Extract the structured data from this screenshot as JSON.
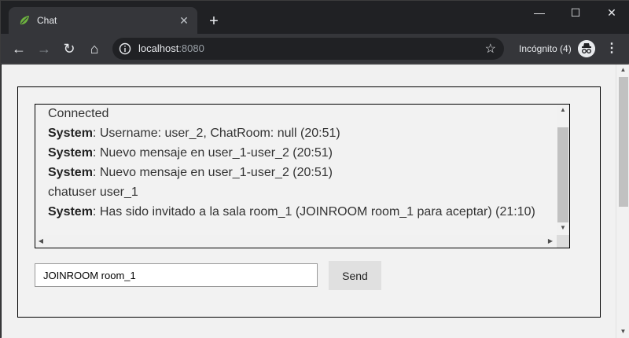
{
  "browser": {
    "tab_title": "Chat",
    "url_host": "localhost",
    "url_port": ":8080",
    "incognito_label": "Incógnito (4)",
    "icons": {
      "favicon": "spring-leaf-icon",
      "close": "close-icon",
      "new_tab": "plus-icon",
      "back": "back-arrow-icon",
      "forward": "forward-arrow-icon",
      "reload": "reload-icon",
      "home": "home-icon",
      "info": "info-icon",
      "star": "star-icon",
      "incognito": "incognito-icon",
      "menu": "kebab-menu-icon"
    },
    "colors": {
      "frame": "#202124",
      "toolbar": "#35363a",
      "favicon_green": "#6db33f"
    }
  },
  "chat": {
    "messages": [
      {
        "sender": "",
        "text": "Connected"
      },
      {
        "sender": "System",
        "text": ": Username: user_2, ChatRoom: null (20:51)"
      },
      {
        "sender": "System",
        "text": ": Nuevo mensaje en user_1-user_2 (20:51)"
      },
      {
        "sender": "System",
        "text": ": Nuevo mensaje en user_1-user_2 (20:51)"
      },
      {
        "sender": "",
        "text": "chatuser user_1"
      },
      {
        "sender": "System",
        "text": ": Has sido invitado a la sala room_1 (JOINROOM room_1 para aceptar) (21:10)"
      }
    ],
    "input_value": "JOINROOM room_1",
    "send_label": "Send"
  }
}
